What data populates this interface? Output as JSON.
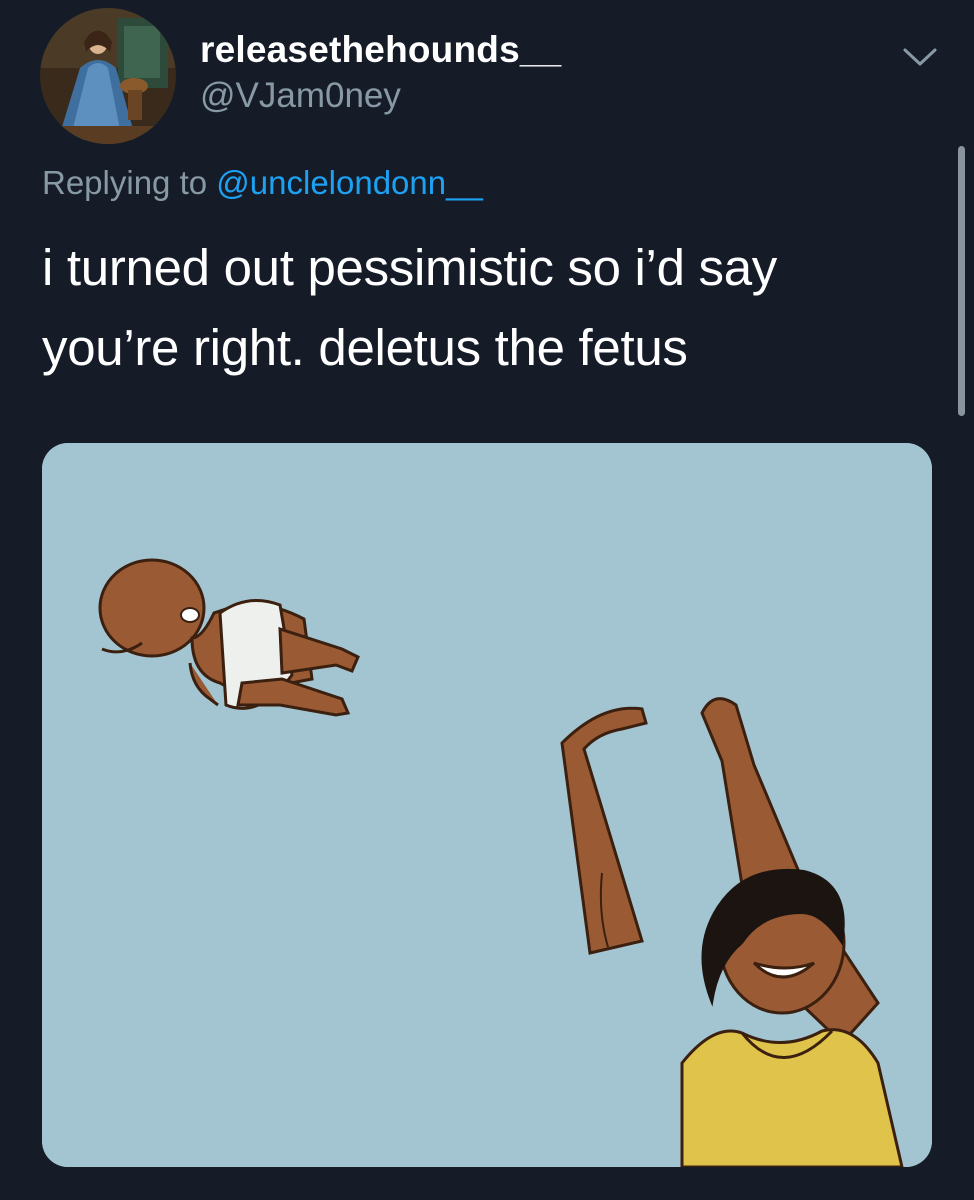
{
  "tweet": {
    "author": {
      "display_name": "releasethehounds__",
      "handle": "@VJam0ney",
      "avatar_icon": "avatar-painting-icon"
    },
    "menu_icon": "chevron-down-icon",
    "reply": {
      "prefix": "Replying to",
      "mention": "@unclelondonn__"
    },
    "text_lines": [
      "i turned out pessimistic so i’d say",
      "you’re right. deletus the fetus"
    ],
    "media": {
      "icon": "baby-toss-meme-image"
    }
  },
  "colors": {
    "background": "#151c28",
    "secondary_text": "#8899a6",
    "link": "#1da1f2",
    "media_sky": "#a3c5d2"
  }
}
